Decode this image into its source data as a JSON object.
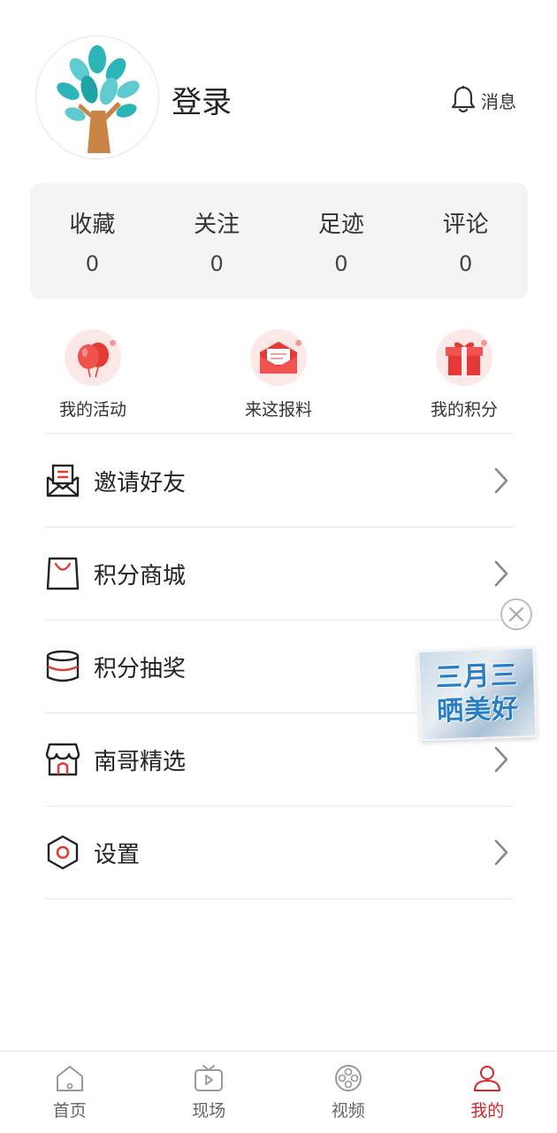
{
  "header": {
    "avatar_icon": "tree-logo-icon",
    "login_label": "登录",
    "message_icon": "bell-icon",
    "message_label": "消息"
  },
  "stats": [
    {
      "label": "收藏",
      "value": "0"
    },
    {
      "label": "关注",
      "value": "0"
    },
    {
      "label": "足迹",
      "value": "0"
    },
    {
      "label": "评论",
      "value": "0"
    }
  ],
  "quick_actions": [
    {
      "label": "我的活动",
      "icon": "balloons-icon"
    },
    {
      "label": "来这报料",
      "icon": "envelope-icon"
    },
    {
      "label": "我的积分",
      "icon": "gift-box-icon"
    }
  ],
  "menu": [
    {
      "label": "邀请好友",
      "icon": "invite-envelope-icon"
    },
    {
      "label": "积分商城",
      "icon": "shopping-bag-icon"
    },
    {
      "label": "积分抽奖",
      "icon": "lottery-drum-icon"
    },
    {
      "label": "南哥精选",
      "icon": "storefront-icon"
    },
    {
      "label": "设置",
      "icon": "hexagon-settings-icon"
    }
  ],
  "ad": {
    "line1": "三月三",
    "line2": "晒美好"
  },
  "tabs": [
    {
      "label": "首页",
      "icon": "home-icon",
      "active": false
    },
    {
      "label": "现场",
      "icon": "tv-play-icon",
      "active": false
    },
    {
      "label": "视频",
      "icon": "film-reel-icon",
      "active": false
    },
    {
      "label": "我的",
      "icon": "user-icon",
      "active": true
    }
  ],
  "colors": {
    "accent": "#d9252d",
    "icon_red": "#e53935",
    "card_bg": "#f4f4f4",
    "tree_leaf": "#2bb5b8",
    "tree_trunk": "#c98546"
  }
}
